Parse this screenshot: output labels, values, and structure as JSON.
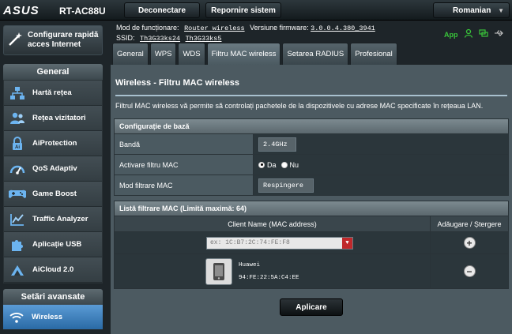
{
  "header": {
    "logo": "ASUS",
    "model": "RT-AC88U",
    "logout_label": "Deconectare",
    "reboot_label": "Repornire sistem",
    "language": "Romanian"
  },
  "info": {
    "mode_label": "Mod de funcționare:",
    "mode_value": "Router wireless",
    "firmware_label": "Versiune firmware:",
    "firmware_value": "3.0.0.4.380_3941",
    "ssid_label": "SSID:",
    "ssid_1": "Th3G33ks24",
    "ssid_2": "Th3G33ks5",
    "app_label": "App"
  },
  "sidebar": {
    "quick_setup": "Configurare rapidă acces Internet",
    "general_title": "General",
    "items": [
      {
        "label": "Hartă rețea",
        "icon": "network-map-icon"
      },
      {
        "label": "Rețea vizitatori",
        "icon": "guest-network-icon"
      },
      {
        "label": "AiProtection",
        "icon": "aiprotection-lock-icon"
      },
      {
        "label": "QoS Adaptiv",
        "icon": "qos-gauge-icon"
      },
      {
        "label": "Game Boost",
        "icon": "gamepad-icon"
      },
      {
        "label": "Traffic Analyzer",
        "icon": "traffic-chart-icon"
      },
      {
        "label": "Aplicație USB",
        "icon": "usb-puzzle-icon"
      },
      {
        "label": "AiCloud 2.0",
        "icon": "aicloud-icon"
      }
    ],
    "advanced_title": "Setări avansate",
    "advanced_items": [
      {
        "label": "Wireless",
        "icon": "wifi-icon"
      }
    ]
  },
  "tabs": [
    "General",
    "WPS",
    "WDS",
    "Filtru MAC wireless",
    "Setarea RADIUS",
    "Profesional"
  ],
  "active_tab": "Filtru MAC wireless",
  "main": {
    "title": "Wireless - Filtru MAC wireless",
    "description": "Filtrul MAC wireless vă permite să controlați pachetele de la dispozitivele cu adrese MAC specificate în rețeaua LAN.",
    "basic_config_title": "Configurație de bază",
    "band_label": "Bandă",
    "band_value": "2.4GHz",
    "enable_label": "Activare filtru MAC",
    "yes_label": "Da",
    "no_label": "Nu",
    "mode_label": "Mod filtrare MAC",
    "mode_value": "Respingere",
    "list_title": "Listă filtrare MAC (Limită maximă: 64)",
    "col_client": "Client Name (MAC address)",
    "col_action": "Adăugare / Ștergere",
    "mac_placeholder": "ex: 1C:B7:2C:74:FE:F8",
    "device_name": "Huawei",
    "device_mac": "94:FE:22:5A:C4:EE",
    "apply_label": "Aplicare"
  },
  "colors": {
    "active_nav": "#3b7fc0",
    "accent_green": "#39c43a",
    "dropdown_red": "#c0282b"
  }
}
